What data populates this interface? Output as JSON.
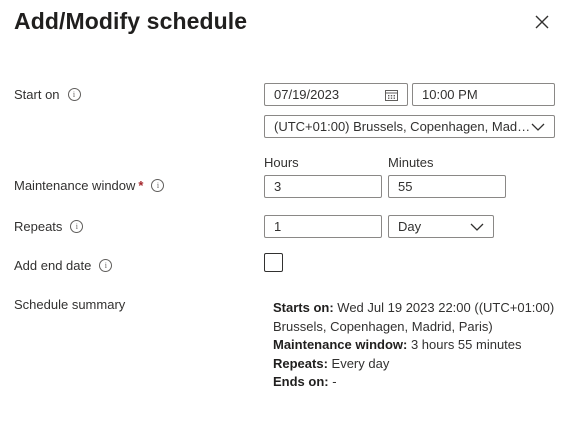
{
  "dialog": {
    "title": "Add/Modify schedule"
  },
  "labels": {
    "start_on": "Start on",
    "maintenance_window": "Maintenance window",
    "required_marker": "*",
    "repeats": "Repeats",
    "add_end_date": "Add end date",
    "schedule_summary": "Schedule summary",
    "hours": "Hours",
    "minutes": "Minutes"
  },
  "fields": {
    "start_date": "07/19/2023",
    "start_time": "10:00 PM",
    "timezone": "(UTC+01:00) Brussels, Copenhagen, Madri...",
    "hours": "3",
    "minutes": "55",
    "repeat_count": "1",
    "repeat_unit": "Day",
    "add_end_date_checked": false
  },
  "summary": {
    "starts_on_label": "Starts on:",
    "starts_on_value": " Wed Jul 19 2023 22:00 ((UTC+01:00) Brussels, Copenhagen, Madrid, Paris)",
    "maintenance_label": "Maintenance window:",
    "maintenance_value": " 3 hours 55 minutes",
    "repeats_label": "Repeats:",
    "repeats_value": " Every day",
    "ends_on_label": "Ends on:",
    "ends_on_value": " -"
  },
  "icons": {
    "info": "info-icon",
    "close": "close-icon",
    "calendar": "calendar-icon",
    "chevron": "chevron-down-icon"
  }
}
